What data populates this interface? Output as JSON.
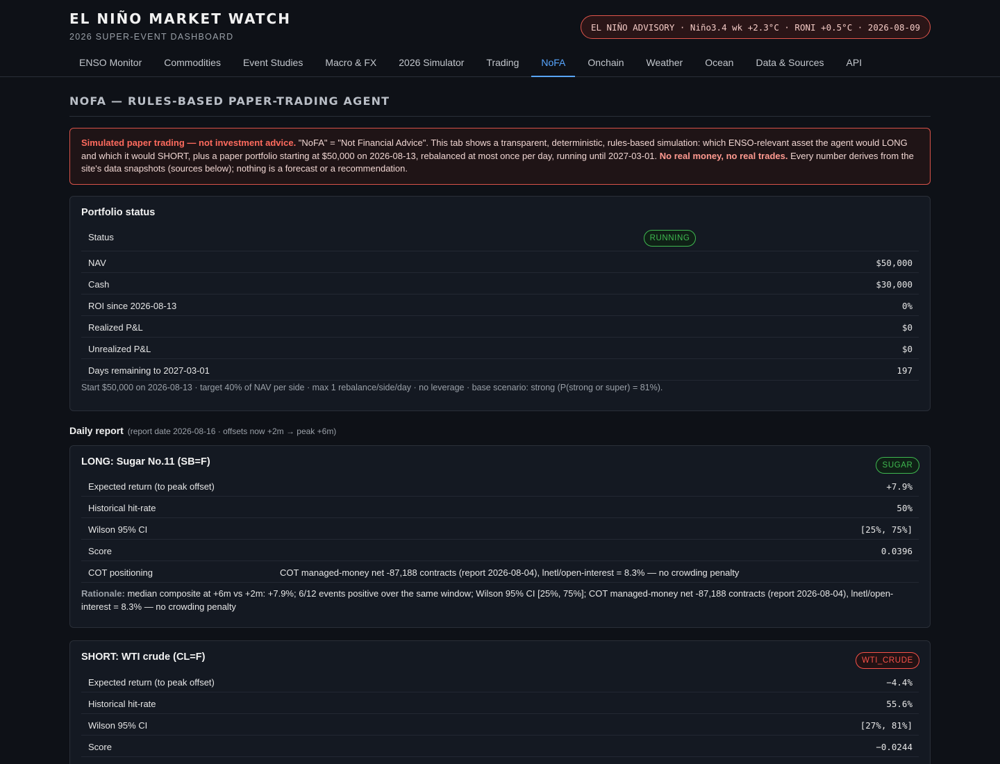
{
  "header": {
    "title": "EL NIÑO MARKET WATCH",
    "subtitle": "2026 SUPER-EVENT DASHBOARD",
    "advisory": "EL NIÑO ADVISORY · Niño3.4 wk +2.3°C · RONI +0.5°C · 2026-08-09"
  },
  "nav": {
    "tabs": [
      "ENSO Monitor",
      "Commodities",
      "Event Studies",
      "Macro & FX",
      "2026 Simulator",
      "Trading",
      "NoFA",
      "Onchain",
      "Weather",
      "Ocean",
      "Data & Sources",
      "API"
    ],
    "active": "NoFA"
  },
  "page": {
    "title": "NOFA — RULES-BASED PAPER-TRADING AGENT"
  },
  "disclaimer": {
    "lead": "Simulated paper trading — not investment advice.",
    "body1": " \"NoFA\" = \"Not Financial Advice\". This tab shows a transparent, deterministic, rules-based simulation: which ENSO-relevant asset the agent would LONG and which it would SHORT, plus a paper portfolio starting at $50,000 on 2026-08-13, rebalanced at most once per day, running until 2027-03-01. ",
    "emph": "No real money, no real trades.",
    "body2": " Every number derives from the site's data snapshots (sources below); nothing is a forecast or a recommendation."
  },
  "portfolio": {
    "title": "Portfolio status",
    "status_label": "Status",
    "status_value": "RUNNING",
    "rows": [
      {
        "label": "NAV",
        "value": "$50,000"
      },
      {
        "label": "Cash",
        "value": "$30,000"
      },
      {
        "label": "ROI since 2026-08-13",
        "value": "0%"
      },
      {
        "label": "Realized P&L",
        "value": "$0"
      },
      {
        "label": "Unrealized P&L",
        "value": "$0"
      },
      {
        "label": "Days remaining to 2027-03-01",
        "value": "197"
      }
    ],
    "footnote": "Start $50,000 on 2026-08-13 · target 40% of NAV per side · max 1 rebalance/side/day · no leverage · base scenario: strong (P(strong or super) = 81%)."
  },
  "daily_report": {
    "heading": "Daily report",
    "sub": "(report date 2026-08-16 · offsets now +2m → peak +6m)"
  },
  "long": {
    "title": "LONG: Sugar No.11 (SB=F)",
    "badge": "SUGAR",
    "rows": [
      {
        "label": "Expected return (to peak offset)",
        "value": "+7.9%"
      },
      {
        "label": "Historical hit-rate",
        "value": "50%"
      },
      {
        "label": "Wilson 95% CI",
        "value": "[25%, 75%]"
      },
      {
        "label": "Score",
        "value": "0.0396"
      }
    ],
    "cot_label": "COT positioning",
    "cot_value": "COT managed-money net -87,188 contracts (report 2026-08-04), lnetl/open-interest = 8.3% — no crowding penalty",
    "rationale_label": "Rationale:",
    "rationale": " median composite at +6m vs +2m: +7.9%; 6/12 events positive over the same window; Wilson 95% CI [25%, 75%]; COT managed-money net -87,188 contracts (report 2026-08-04), lnetl/open-interest = 8.3% — no crowding penalty"
  },
  "short": {
    "title": "SHORT: WTI crude (CL=F)",
    "badge": "WTI_CRUDE",
    "rows": [
      {
        "label": "Expected return (to peak offset)",
        "value": "−4.4%"
      },
      {
        "label": "Historical hit-rate",
        "value": "55.6%"
      },
      {
        "label": "Wilson 95% CI",
        "value": "[27%, 81%]"
      },
      {
        "label": "Score",
        "value": "−0.0244"
      }
    ]
  },
  "colors": {
    "accent": "#58a6ff",
    "positive": "#3fb950",
    "negative": "#f85149",
    "warning": "#ff6b5e"
  }
}
